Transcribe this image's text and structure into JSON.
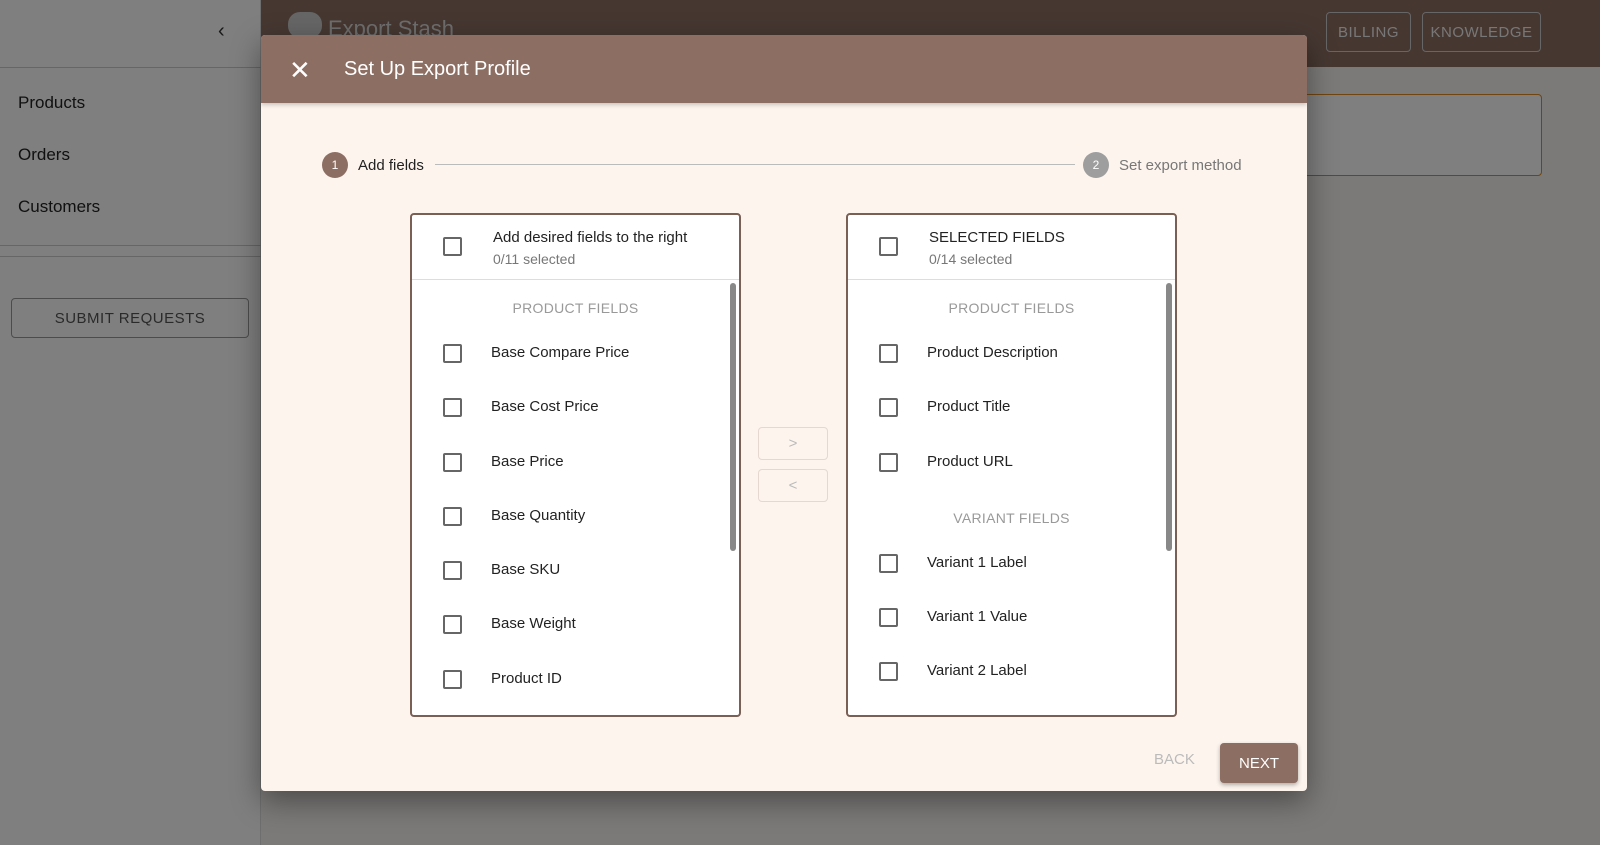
{
  "sidebar": {
    "items": [
      "Products",
      "Orders",
      "Customers"
    ],
    "submit": "SUBMIT REQUESTS"
  },
  "header": {
    "brand": "Export Stash",
    "billing": "BILLING",
    "knowledge": "KNOWLEDGE"
  },
  "modal": {
    "title": "Set Up Export Profile",
    "steps": [
      {
        "num": "1",
        "label": "Add fields"
      },
      {
        "num": "2",
        "label": "Set export method"
      }
    ],
    "left": {
      "title": "Add desired fields to the right",
      "count": "0/11 selected",
      "section": "PRODUCT FIELDS",
      "items": [
        "Base Compare Price",
        "Base Cost Price",
        "Base Price",
        "Base Quantity",
        "Base SKU",
        "Base Weight",
        "Product ID"
      ]
    },
    "right": {
      "title": "SELECTED FIELDS",
      "count": "0/14 selected",
      "section1": "PRODUCT FIELDS",
      "items1": [
        "Product Description",
        "Product Title",
        "Product URL"
      ],
      "section2": "VARIANT FIELDS",
      "items2": [
        "Variant 1 Label",
        "Variant 1 Value",
        "Variant 2 Label"
      ]
    },
    "move_right": ">",
    "move_left": "<",
    "back": "BACK",
    "next": "NEXT"
  }
}
